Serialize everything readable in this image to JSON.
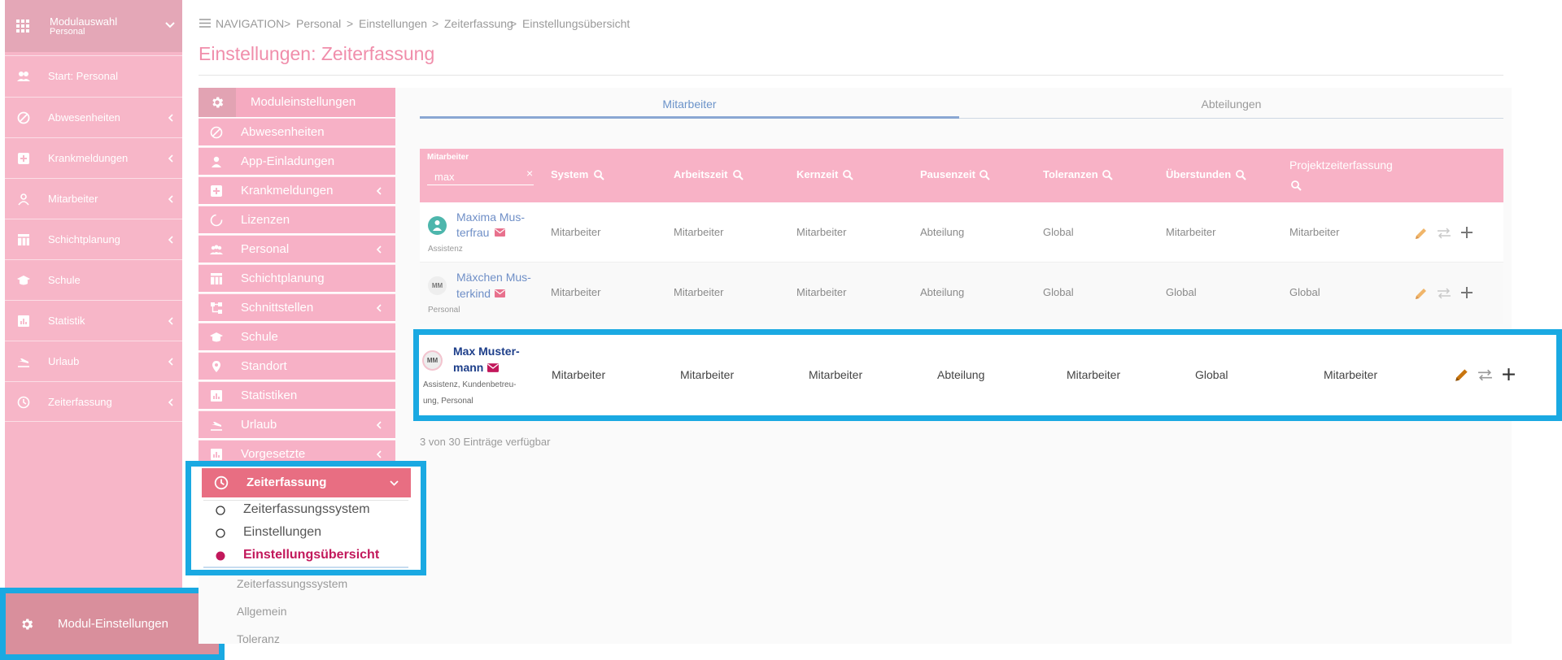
{
  "sidebar": {
    "module_title": "Modulauswahl",
    "module_subtitle": "Personal",
    "items": [
      {
        "label": "Start: Personal",
        "icon": "people-icon"
      },
      {
        "label": "Abwesenheiten",
        "icon": "block-icon"
      },
      {
        "label": "Krankmeldungen",
        "icon": "medical-icon"
      },
      {
        "label": "Mitarbeiter",
        "icon": "person-icon"
      },
      {
        "label": "Schichtplanung",
        "icon": "table-icon"
      },
      {
        "label": "Schule",
        "icon": "school-icon"
      },
      {
        "label": "Statistik",
        "icon": "chart-icon"
      },
      {
        "label": "Urlaub",
        "icon": "plane-icon"
      },
      {
        "label": "Zeiterfassung",
        "icon": "clock-icon"
      }
    ],
    "footer_label": "Modul-Einstellungen"
  },
  "breadcrumb": {
    "nav": "NAVIGATION",
    "items": [
      "Personal",
      "Einstellungen",
      "Zeiterfassung",
      "Einstellungsübersicht"
    ]
  },
  "page_title": "Einstellungen: Zeiterfassung",
  "submenu": {
    "header": "Moduleinstellungen",
    "items": [
      "Abwesenheiten",
      "App-Einladungen",
      "Krankmeldungen",
      "Lizenzen",
      "Personal",
      "Schichtplanung",
      "Schnittstellen",
      "Schule",
      "Standort",
      "Statistiken",
      "Urlaub",
      "Vorgesetzte"
    ],
    "active": "Zeiterfassung",
    "active_children": [
      "Zeiterfassungssystem",
      "Einstellungen",
      "Einstellungsübersicht"
    ],
    "more_items": [
      "Zeiterfassungssystem",
      "Allgemein",
      "Toleranz"
    ]
  },
  "tabs": [
    "Mitarbeiter",
    "Abteilungen"
  ],
  "table": {
    "filter_label": "Mitarbeiter",
    "filter_value": "max",
    "columns": [
      "System",
      "Arbeitszeit",
      "Kernzeit",
      "Pausenzeit",
      "Toleranzen",
      "Überstunden",
      "Projektzeiterfassung"
    ],
    "rows": [
      {
        "name1": "Maxima Mus-",
        "name2": "terfrau",
        "sub1": "Assistenz",
        "sub2": "",
        "cells": [
          "Mitarbeiter",
          "Mitarbeiter",
          "Mitarbeiter",
          "Abteilung",
          "Global",
          "Mitarbeiter",
          "Mitarbeiter"
        ]
      },
      {
        "name1": "Mäxchen Mus-",
        "name2": "terkind",
        "avatar": "MM",
        "sub1": "Personal",
        "sub2": "",
        "cells": [
          "Mitarbeiter",
          "Mitarbeiter",
          "Mitarbeiter",
          "Abteilung",
          "Global",
          "Global",
          "Global"
        ]
      },
      {
        "name1": "Max Muster-",
        "name2": "mann",
        "avatar": "MM",
        "sub1": "Assistenz, Kundenbetreu-",
        "sub2": "ung, Personal",
        "cells": [
          "Mitarbeiter",
          "Mitarbeiter",
          "Mitarbeiter",
          "Abteilung",
          "Mitarbeiter",
          "Global",
          "Mitarbeiter"
        ]
      }
    ],
    "footer": "3 von 30 Einträge verfügbar"
  }
}
